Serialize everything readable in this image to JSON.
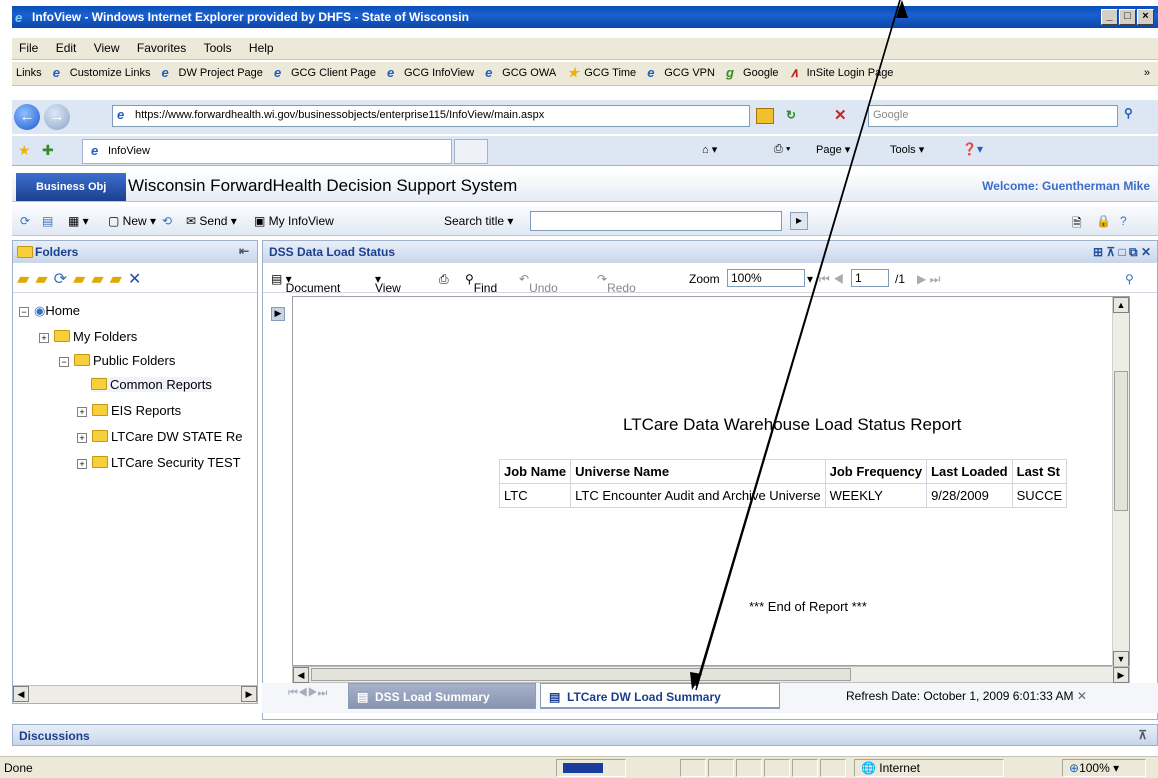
{
  "window": {
    "title": "InfoView - Windows Internet Explorer provided by DHFS - State of Wisconsin"
  },
  "menu": [
    "File",
    "Edit",
    "View",
    "Favorites",
    "Tools",
    "Help"
  ],
  "links": {
    "label": "Links",
    "items": [
      "Customize Links",
      "DW Project Page",
      "GCG Client Page",
      "GCG InfoView",
      "GCG OWA",
      "GCG Time",
      "GCG VPN",
      "Google",
      "InSite Login Page"
    ]
  },
  "address": {
    "url": "https://www.forwardhealth.wi.gov/businessobjects/enterprise115/InfoView/main.aspx",
    "search_placeholder": "Google"
  },
  "tabbar": {
    "tab_label": "InfoView",
    "page_label": "Page",
    "tools_label": "Tools"
  },
  "app": {
    "logo": "Business Obj",
    "title": "Wisconsin ForwardHealth Decision Support System",
    "welcome": "Welcome: Guentherman Mike"
  },
  "apptoolbar": {
    "new": "New",
    "send": "Send",
    "myinfoview": "My InfoView",
    "search_title": "Search title"
  },
  "folders": {
    "header": "Folders",
    "items": [
      {
        "label": "Home",
        "expander": "⊟"
      },
      {
        "label": "My Folders",
        "expander": "⊞"
      },
      {
        "label": "Public Folders",
        "expander": "⊟"
      },
      {
        "label": "Common Reports",
        "expander": ""
      },
      {
        "label": "EIS Reports",
        "expander": "⊞"
      },
      {
        "label": "LTCare DW STATE Re",
        "expander": "⊞"
      },
      {
        "label": "LTCare Security TEST",
        "expander": "⊞"
      }
    ]
  },
  "dss": {
    "header": "DSS Data Load Status",
    "toolbar": {
      "document": "Document",
      "view": "View",
      "find": "Find",
      "undo": "Undo",
      "redo": "Redo",
      "zoom_label": "Zoom",
      "zoom_value": "100%",
      "page_value": "1",
      "page_total": "/1"
    },
    "report": {
      "title": "LTCare Data Warehouse Load Status Report",
      "columns": [
        "Job Name",
        "Universe Name",
        "Job Frequency",
        "Last Loaded",
        "Last St"
      ],
      "rows": [
        [
          "LTC",
          "LTC Encounter Audit and Archive Universe",
          "WEEKLY",
          "9/28/2009",
          "SUCCE"
        ]
      ],
      "end": "*** End of Report ***"
    },
    "tabs": [
      "DSS Load Summary",
      "LTCare DW Load Summary"
    ],
    "refresh": "Refresh Date: October 1, 2009 6:01:33 AM"
  },
  "discussions": {
    "label": "Discussions"
  },
  "status": {
    "left": "Done",
    "zone": "Internet",
    "zoom": "100%"
  },
  "colors": {
    "accent": "#1b3f8f",
    "titlebar": "#0a4fb5",
    "folder": "#f6cf3a"
  }
}
